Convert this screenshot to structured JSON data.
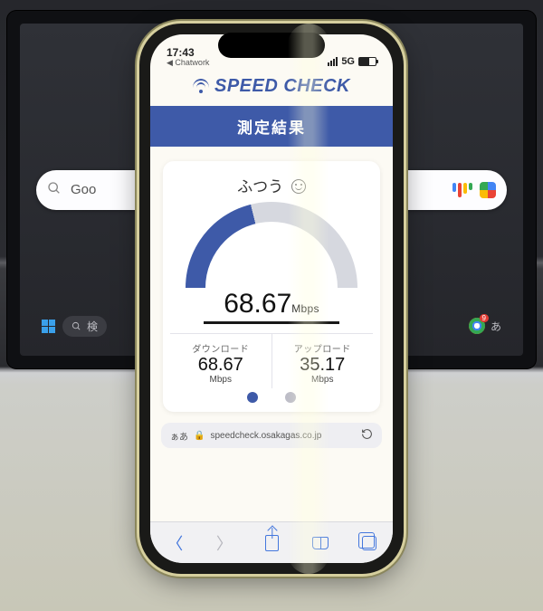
{
  "laptop": {
    "search_placeholder": "Goo",
    "taskbar_search": "検",
    "ime": "あ",
    "chrome_badge": "9"
  },
  "status": {
    "time": "17:43",
    "back_app": "Chatwork",
    "carrier_net": "5G",
    "battery_pct": "59"
  },
  "brand": {
    "name": "SPEED CHECK"
  },
  "banner": {
    "title": "測定結果"
  },
  "result": {
    "rating_text": "ふつう",
    "main_value": "68.67",
    "main_unit": "Mbps",
    "gauge_fraction": 0.42,
    "download_label": "ダウンロード",
    "download_value": "68.67",
    "download_unit": "Mbps",
    "upload_label": "アップロード",
    "upload_value": "35.17",
    "upload_unit": "Mbps"
  },
  "url": {
    "reader": "ぁあ",
    "host": "speedcheck.osakagas.co.jp"
  },
  "chart_data": {
    "type": "gauge",
    "value": 68.67,
    "unit": "Mbps",
    "range": [
      0,
      160
    ],
    "fill_fraction": 0.42,
    "series": [
      {
        "name": "ダウンロード",
        "value": 68.67,
        "unit": "Mbps"
      },
      {
        "name": "アップロード",
        "value": 35.17,
        "unit": "Mbps"
      }
    ],
    "rating": "ふつう"
  }
}
